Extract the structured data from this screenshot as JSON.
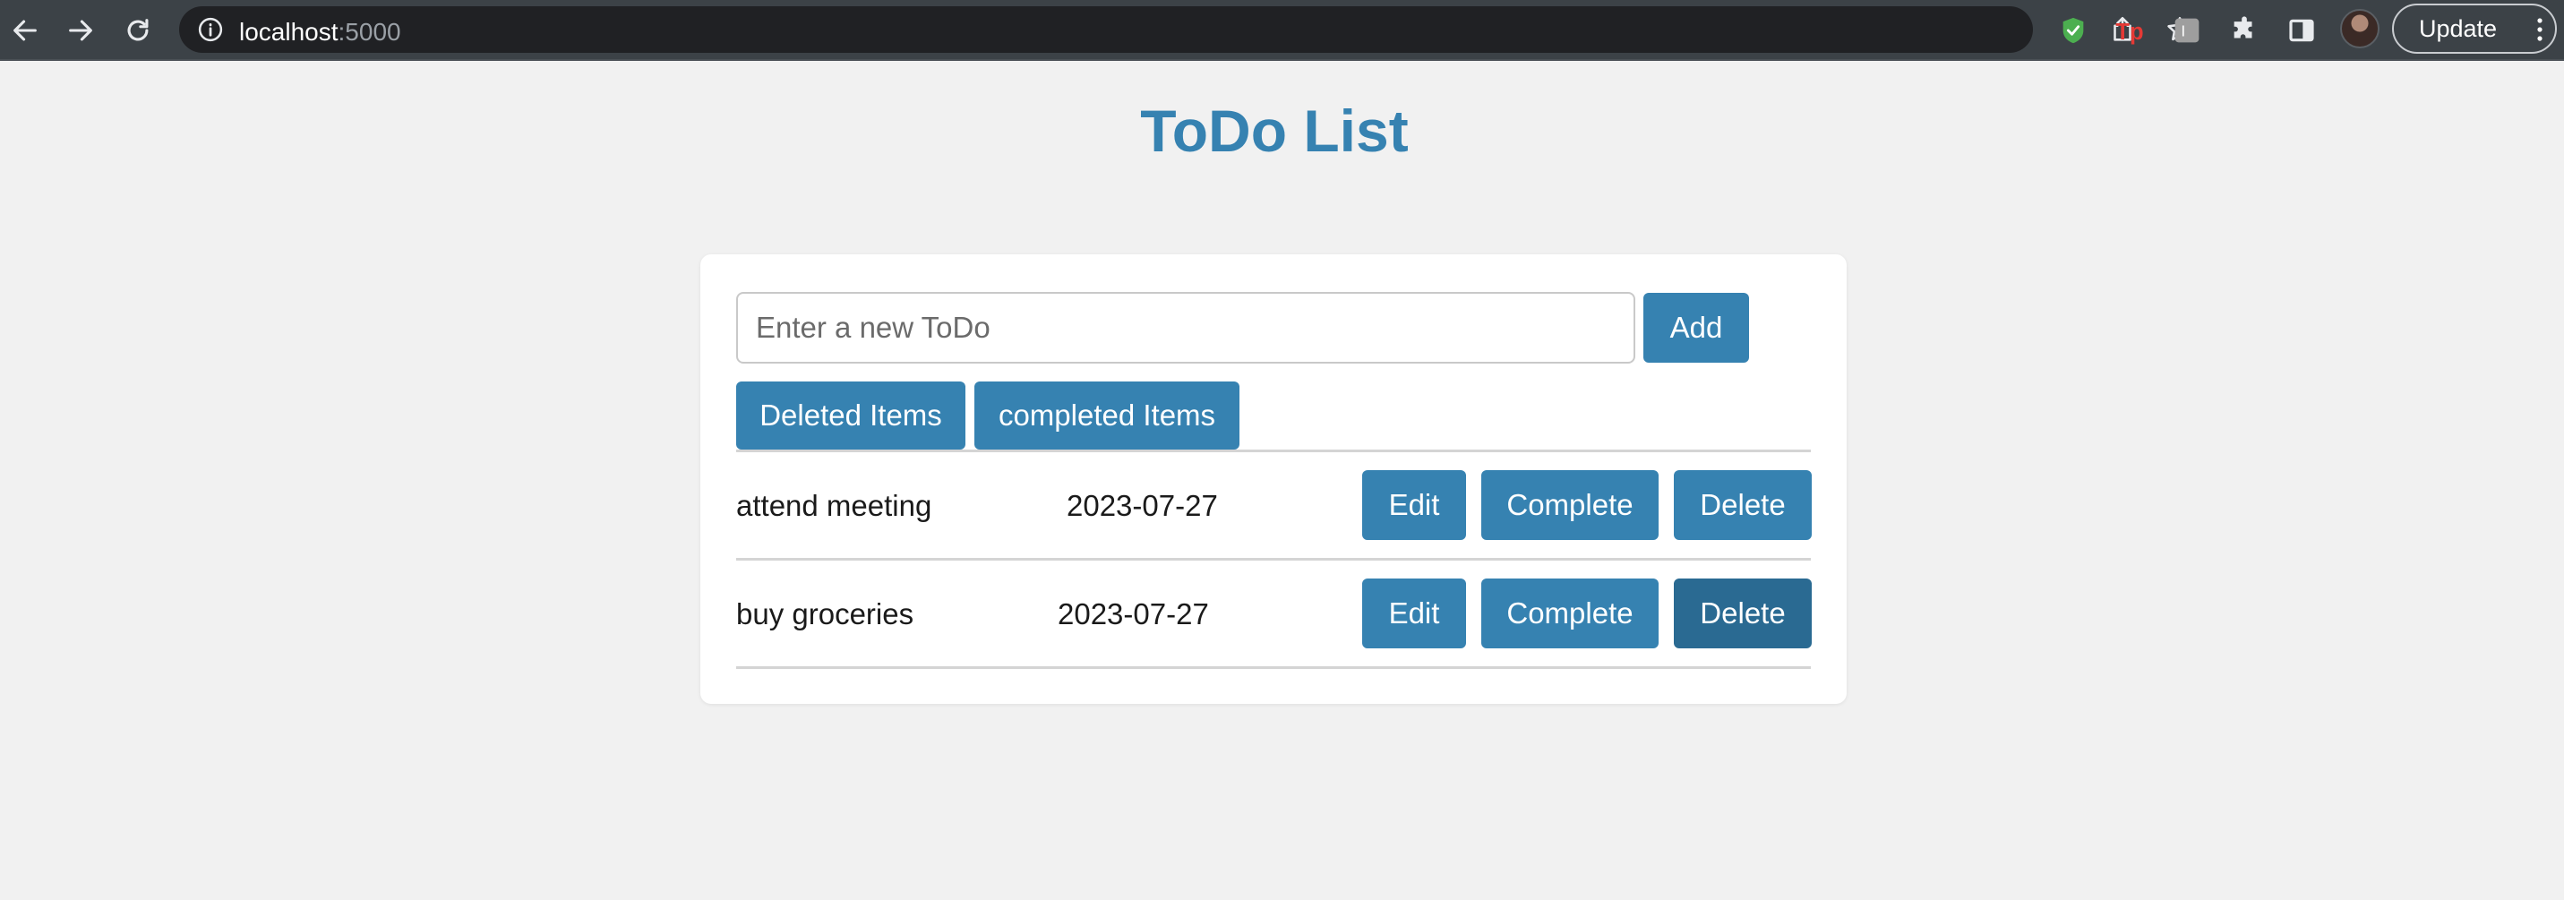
{
  "browser": {
    "url_host": "localhost",
    "url_port": ":5000",
    "update_label": "Update",
    "accent": "#3c4247"
  },
  "page": {
    "title": "ToDo List",
    "accent": "#3682b1"
  },
  "form": {
    "placeholder": "Enter a new ToDo",
    "add_label": "Add",
    "deleted_items_label": "Deleted Items",
    "completed_items_label": "completed Items"
  },
  "todos": [
    {
      "text": "attend meeting",
      "date": "2023-07-27",
      "edit_label": "Edit",
      "complete_label": "Complete",
      "delete_label": "Delete"
    },
    {
      "text": "buy groceries",
      "date": "2023-07-27",
      "edit_label": "Edit",
      "complete_label": "Complete",
      "delete_label": "Delete"
    }
  ]
}
